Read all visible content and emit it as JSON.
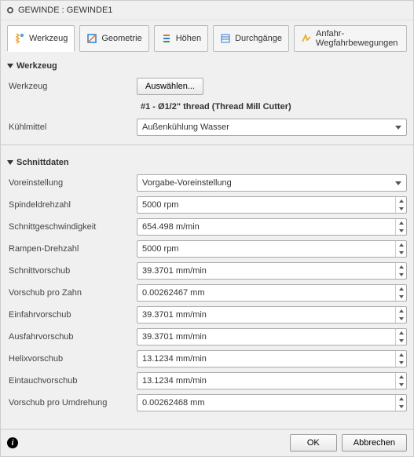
{
  "window": {
    "title": "GEWINDE : GEWINDE1"
  },
  "tabs": {
    "werkzeug": "Werkzeug",
    "geometrie": "Geometrie",
    "hoehen": "Höhen",
    "durchgaenge": "Durchgänge",
    "anfahr": "Anfahr-Wegfahrbewegungen"
  },
  "section_werkzeug": {
    "title": "Werkzeug",
    "tool_label": "Werkzeug",
    "tool_button": "Auswählen...",
    "tool_desc": "#1 - Ø1/2\" thread (Thread Mill Cutter)",
    "coolant_label": "Kühlmittel",
    "coolant_value": "Außenkühlung Wasser"
  },
  "section_schnitt": {
    "title": "Schnittdaten",
    "preset_label": "Voreinstellung",
    "preset_value": "Vorgabe-Voreinstellung",
    "fields": [
      {
        "label": "Spindeldrehzahl",
        "value": "5000 rpm"
      },
      {
        "label": "Schnittgeschwindigkeit",
        "value": "654.498 m/min"
      },
      {
        "label": "Rampen-Drehzahl",
        "value": "5000 rpm"
      },
      {
        "label": "Schnittvorschub",
        "value": "39.3701 mm/min"
      },
      {
        "label": "Vorschub pro Zahn",
        "value": "0.00262467 mm"
      },
      {
        "label": "Einfahrvorschub",
        "value": "39.3701 mm/min"
      },
      {
        "label": "Ausfahrvorschub",
        "value": "39.3701 mm/min"
      },
      {
        "label": "Helixvorschub",
        "value": "13.1234 mm/min"
      },
      {
        "label": "Eintauchvorschub",
        "value": "13.1234 mm/min"
      },
      {
        "label": "Vorschub pro Umdrehung",
        "value": "0.00262468 mm"
      }
    ]
  },
  "footer": {
    "ok": "OK",
    "cancel": "Abbrechen"
  }
}
